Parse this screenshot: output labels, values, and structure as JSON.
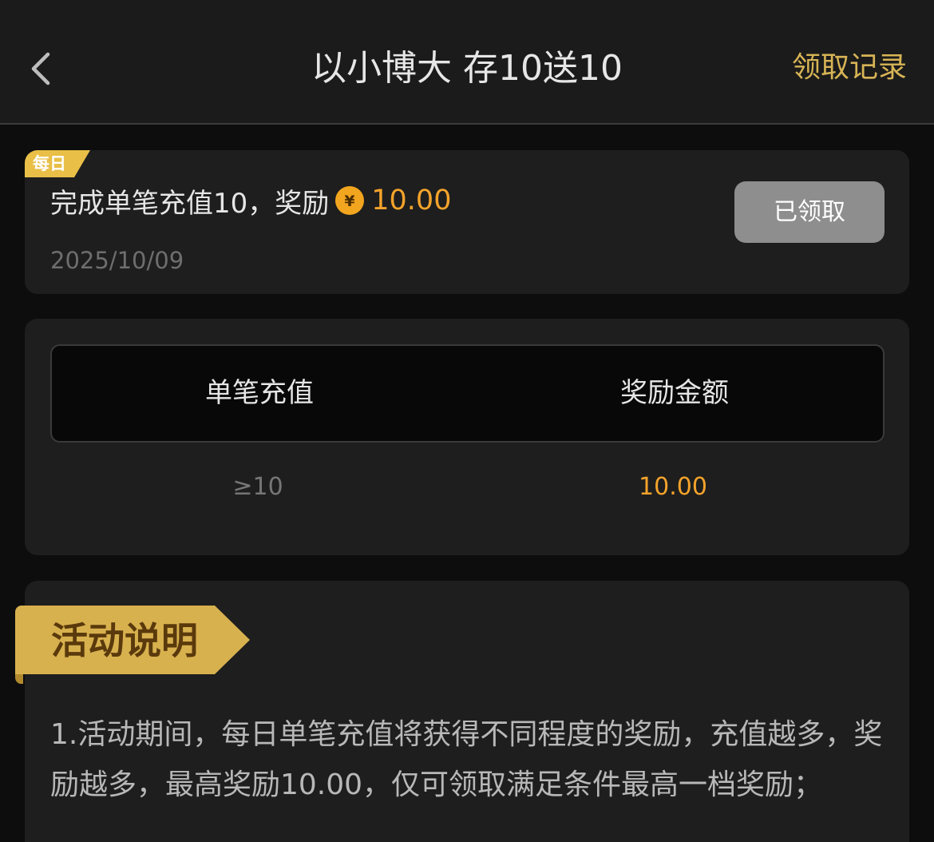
{
  "header": {
    "title": "以小博大 存10送10",
    "records_link": "领取记录"
  },
  "task": {
    "tag": "每日",
    "description": "完成单笔充值10，奖励",
    "reward": "10.00",
    "date": "2025/10/09",
    "button_label": "已领取"
  },
  "table": {
    "columns": [
      "单笔充值",
      "奖励金额"
    ],
    "rows": [
      {
        "deposit": "≥10",
        "reward": "10.00"
      }
    ]
  },
  "rules": {
    "heading": "活动说明",
    "text": "1.活动期间，每日单笔充值将获得不同程度的奖励，充值越多，奖励越多，最高奖励10.00，仅可领取满足条件最高一档奖励；"
  },
  "colors": {
    "accent_gold": "#d7b455",
    "reward_orange": "#f4a32b",
    "background": "#0d0d0d",
    "card": "#1e1e1e"
  },
  "icons": {
    "back": "chevron-left-icon",
    "coin": "yuan-coin-icon"
  }
}
